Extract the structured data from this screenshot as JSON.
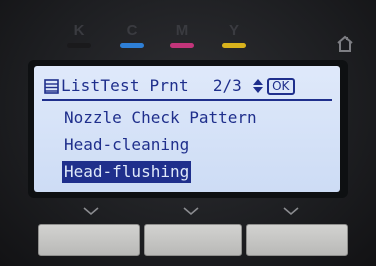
{
  "inks": [
    {
      "letter": "K",
      "color": "#1a1a1c"
    },
    {
      "letter": "C",
      "color": "#2e7fd6"
    },
    {
      "letter": "M",
      "color": "#c2357a"
    },
    {
      "letter": "Y",
      "color": "#d8b21c"
    }
  ],
  "icons": {
    "home": "home-icon",
    "list": "list-icon",
    "scroll": "up-down-arrows-icon",
    "softkey": "chevron-down-icon"
  },
  "lcd": {
    "title": "ListTest Prnt",
    "page": "2/3",
    "ok_label": "OK",
    "items": [
      "Nozzle Check Pattern",
      "Head-cleaning",
      "Head-flushing"
    ],
    "selected_index": 2
  },
  "colors": {
    "lcd_background": "#dfe9fa",
    "lcd_text": "#1f2f8c"
  }
}
